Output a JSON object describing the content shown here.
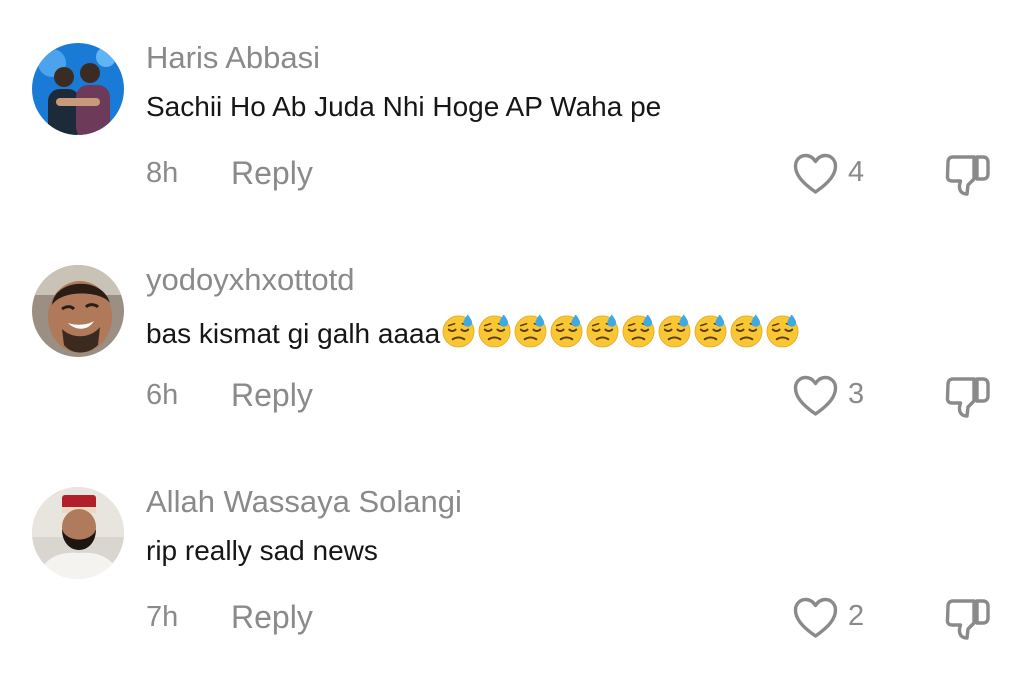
{
  "comments": [
    {
      "username": "Haris Abbasi",
      "text": "Sachii Ho Ab Juda Nhi Hoge AP Waha pe",
      "emojis": [],
      "time": "8h",
      "reply_label": "Reply",
      "likes": "4"
    },
    {
      "username": "yodoyxhxottotd",
      "text": "bas kismat gi galh aaaa",
      "emojis": [
        "downcast-sweat",
        "downcast-sweat",
        "downcast-sweat",
        "downcast-sweat",
        "downcast-sweat",
        "downcast-sweat",
        "downcast-sweat",
        "downcast-sweat",
        "downcast-sweat",
        "downcast-sweat"
      ],
      "time": "6h",
      "reply_label": "Reply",
      "likes": "3"
    },
    {
      "username": "Allah Wassaya Solangi",
      "text": "rip really sad news",
      "emojis": [],
      "time": "7h",
      "reply_label": "Reply",
      "likes": "2"
    }
  ],
  "colors": {
    "meta_text": "#8a8a8a",
    "body_text": "#161616",
    "icon": "#8a8a8a",
    "background": "#ffffff"
  }
}
